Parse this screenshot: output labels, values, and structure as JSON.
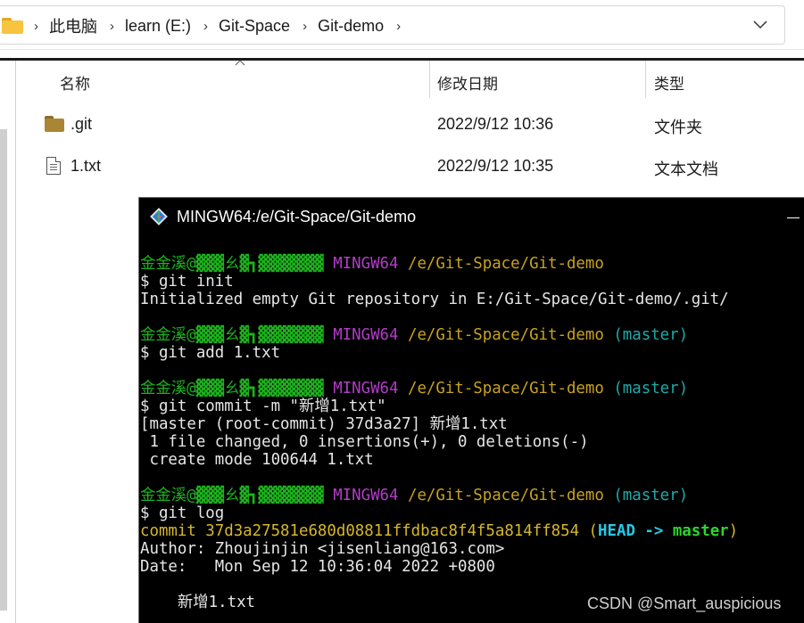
{
  "explorer": {
    "breadcrumb": [
      "此电脑",
      "learn (E:)",
      "Git-Space",
      "Git-demo"
    ],
    "breadcrumb_separator": "›",
    "columns": {
      "name": "名称",
      "modified": "修改日期",
      "type": "类型"
    },
    "files": [
      {
        "name": ".git",
        "modified": "2022/9/12 10:36",
        "type": "文件夹",
        "icon": "folder-icon"
      },
      {
        "name": "1.txt",
        "modified": "2022/9/12 10:35",
        "type": "文本文档",
        "icon": "text-file-icon"
      }
    ]
  },
  "terminal": {
    "title": "MINGW64:/e/Git-Space/Git-demo",
    "prompt_user": "金金溪@",
    "prompt_masked": "▓▓▓ㄠ▓┓▓▓▓▓▓▓▓",
    "prompt_env": "MINGW64",
    "prompt_path": "/e/Git-Space/Git-demo",
    "prompt_branch": "(master)",
    "commands": {
      "c1": "$ git init",
      "c2": "$ git add 1.txt",
      "c3": "$ git commit -m \"新增1.txt\"",
      "c4": "$ git log"
    },
    "output": {
      "init": "Initialized empty Git repository in E:/Git-Space/Git-demo/.git/",
      "commit_line1": "[master (root-commit) 37d3a27] 新增1.txt",
      "commit_line2": " 1 file changed, 0 insertions(+), 0 deletions(-)",
      "commit_line3": " create mode 100644 1.txt",
      "log_commit_prefix": "commit 37d3a27581e680d08811ffdbac8f4f5a814ff854 (",
      "log_head": "HEAD -> ",
      "log_master": "master",
      "log_close": ")",
      "log_author": "Author: Zhoujinjin <jisenliang@163.com>",
      "log_date": "Date:   Mon Sep 12 10:36:04 2022 +0800",
      "log_message": "    新增1.txt"
    }
  },
  "watermark": "CSDN @Smart_auspicious",
  "colors": {
    "terminal_bg": "#000000",
    "prompt_green": "#1db11d",
    "prompt_magenta": "#b23cc8",
    "prompt_yellow": "#c8a21e",
    "prompt_cyan": "#20a8a8"
  }
}
